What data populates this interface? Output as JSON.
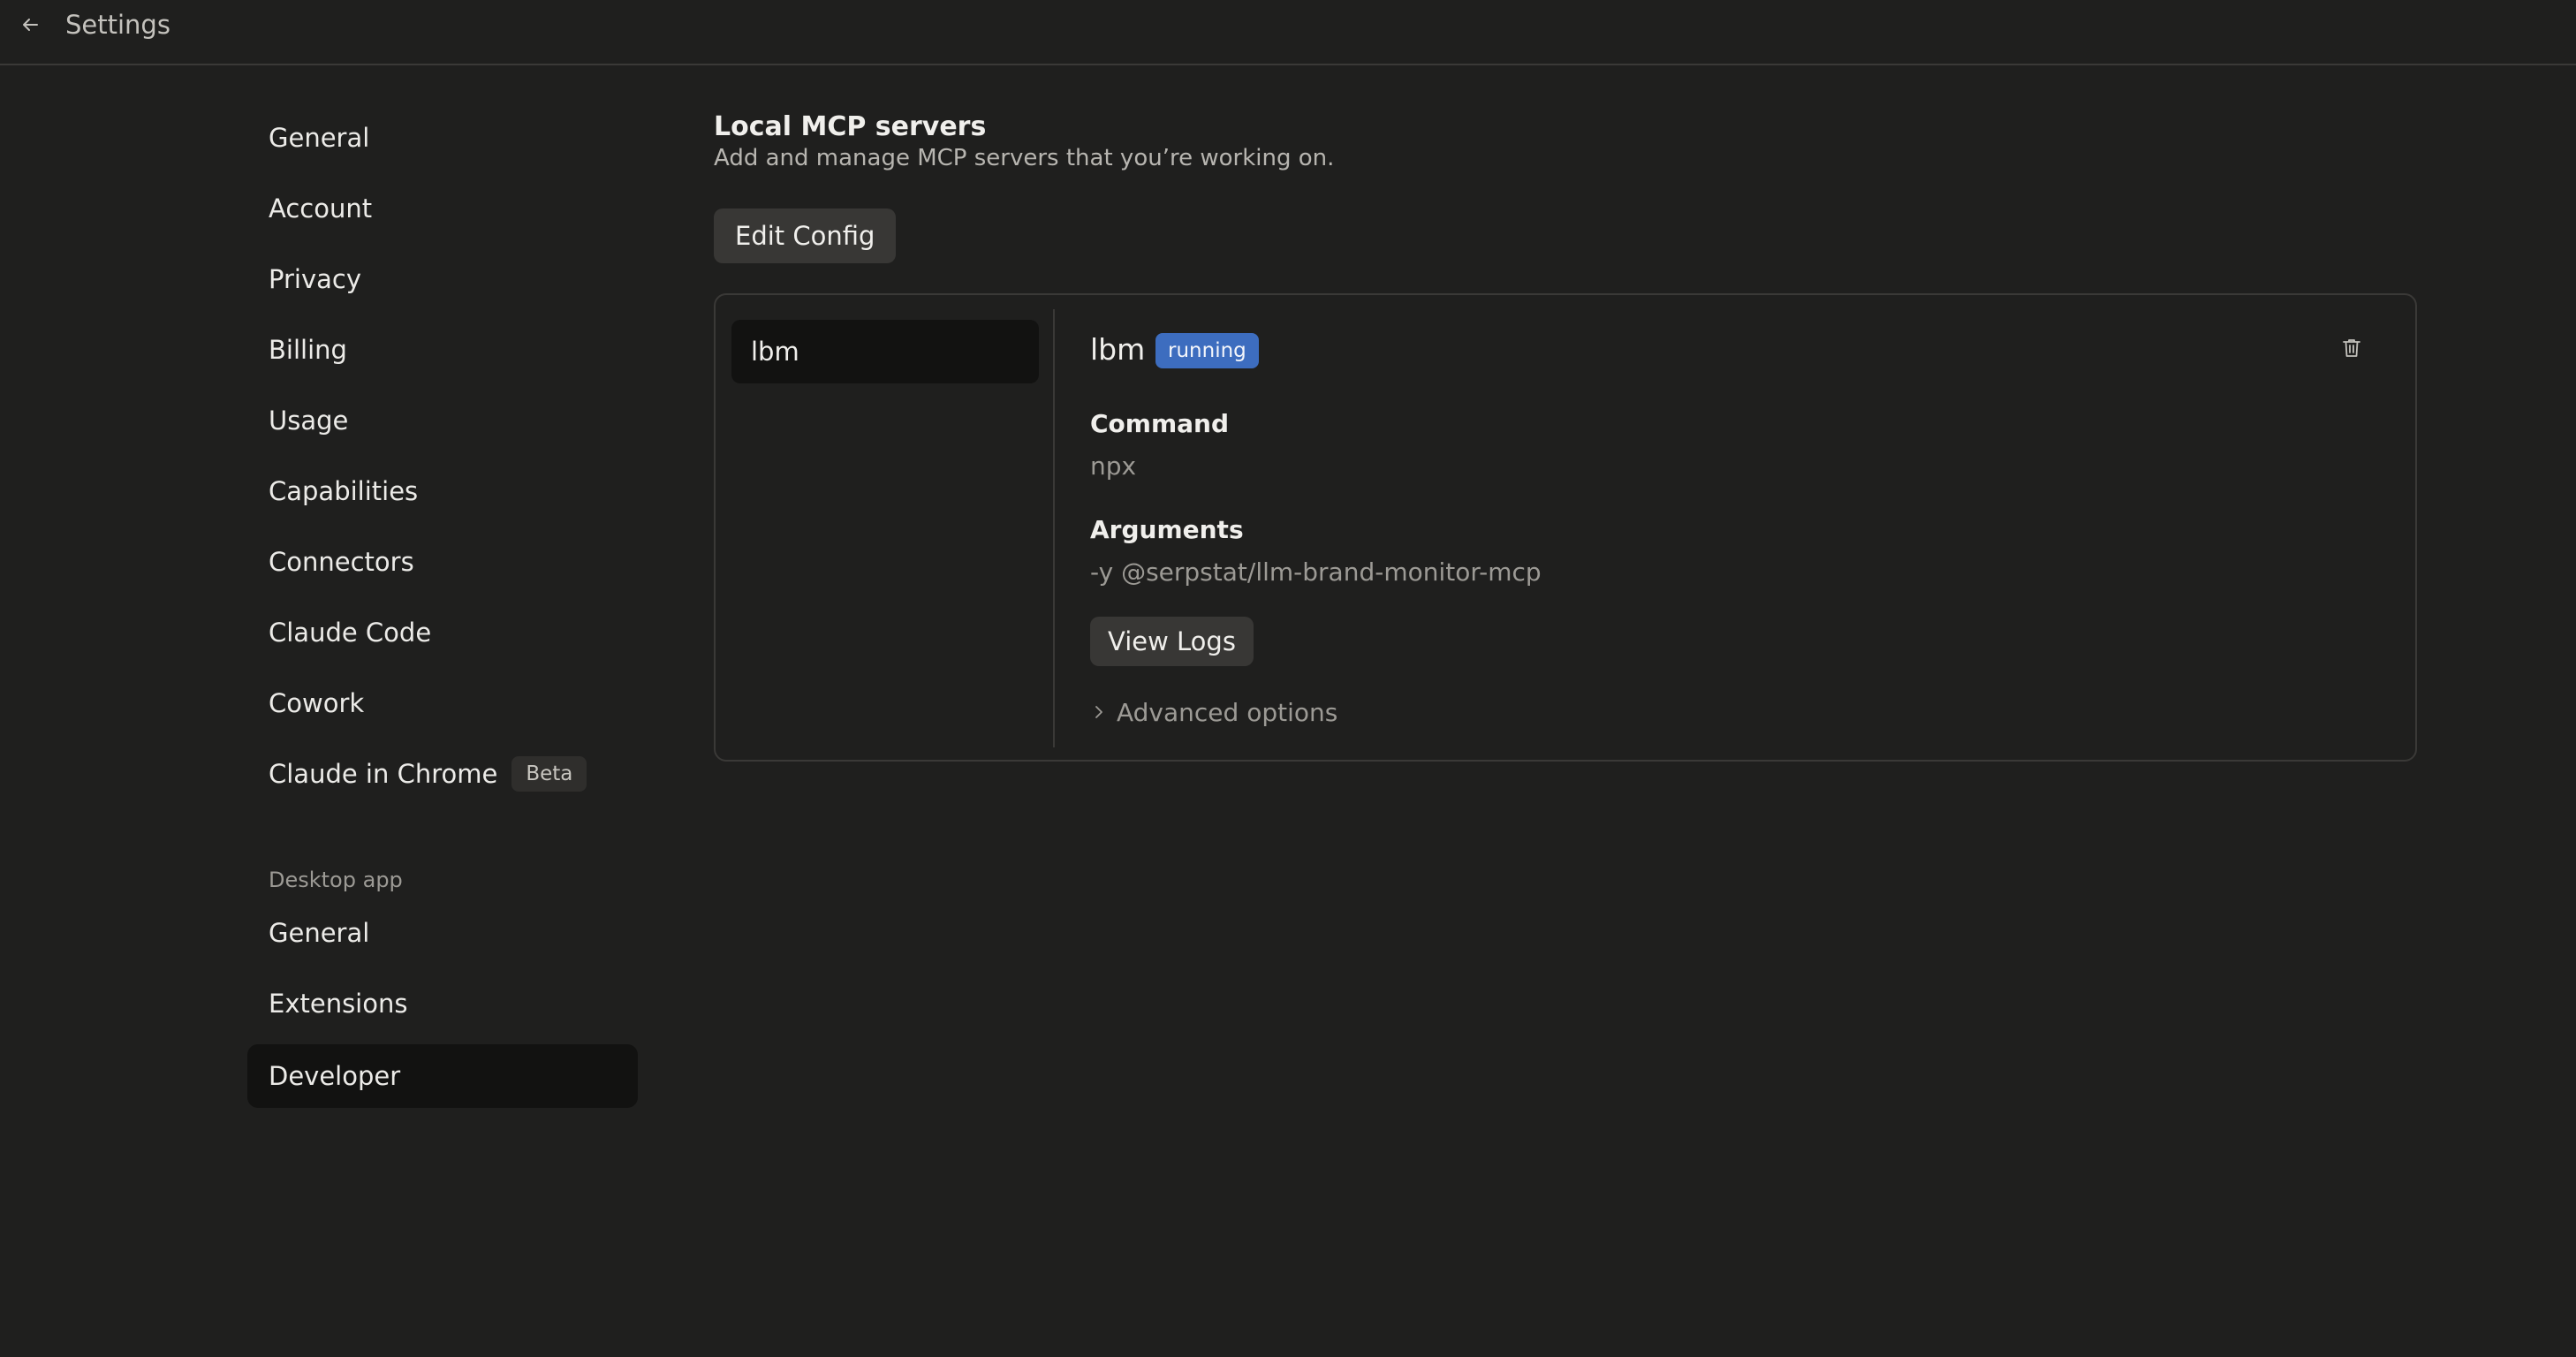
{
  "header": {
    "back_icon": "arrow-left-icon",
    "title": "Settings"
  },
  "sidebar": {
    "items": [
      {
        "label": "General"
      },
      {
        "label": "Account"
      },
      {
        "label": "Privacy"
      },
      {
        "label": "Billing"
      },
      {
        "label": "Usage"
      },
      {
        "label": "Capabilities"
      },
      {
        "label": "Connectors"
      },
      {
        "label": "Claude Code"
      },
      {
        "label": "Cowork"
      },
      {
        "label": "Claude in Chrome",
        "badge": "Beta"
      }
    ],
    "desktop_section_label": "Desktop app",
    "desktop_items": [
      {
        "label": "General"
      },
      {
        "label": "Extensions"
      },
      {
        "label": "Developer",
        "active": true
      }
    ]
  },
  "main": {
    "title": "Local MCP servers",
    "description": "Add and manage MCP servers that you’re working on.",
    "edit_config_label": "Edit Config",
    "servers": [
      {
        "name": "lbm"
      }
    ],
    "detail": {
      "name": "lbm",
      "status": "running",
      "status_color": "#3d6dbf",
      "delete_icon": "trash-icon",
      "command_label": "Command",
      "command_value": "npx",
      "arguments_label": "Arguments",
      "arguments_value": "-y @serpstat/llm-brand-monitor-mcp",
      "view_logs_label": "View Logs",
      "advanced_icon": "chevron-right-icon",
      "advanced_label": "Advanced options"
    }
  }
}
